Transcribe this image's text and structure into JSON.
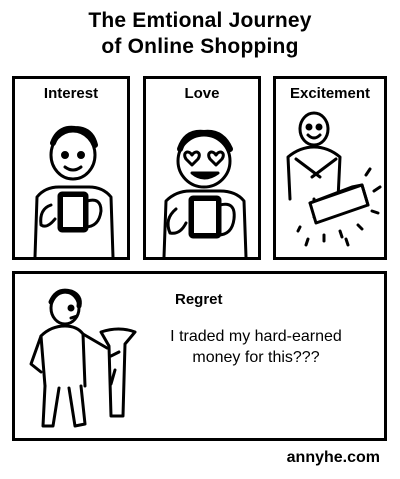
{
  "title": {
    "line1": "The Emtional Journey",
    "line2": "of Online Shopping"
  },
  "panels": [
    {
      "label": "Interest",
      "scene": "person-holding-phone-smiling"
    },
    {
      "label": "Love",
      "scene": "person-with-heart-eyes-holding-phone"
    },
    {
      "label": "Excitement",
      "scene": "person-excited-with-package"
    },
    {
      "label": "Regret",
      "scene": "person-holding-garment",
      "speech": "I traded my hard-earned money for this???"
    }
  ],
  "credit": "annyhe.com"
}
